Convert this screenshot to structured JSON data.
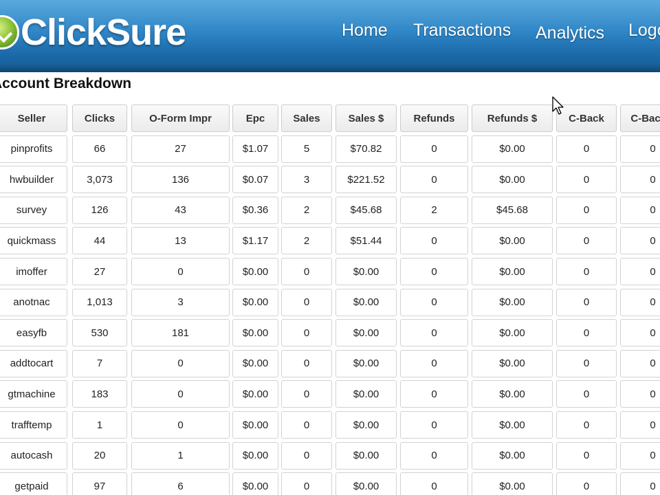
{
  "app": {
    "logo_text": "ClickSure"
  },
  "nav": {
    "items": [
      {
        "label": "Home"
      },
      {
        "label": "Transactions"
      },
      {
        "label": "Analytics"
      },
      {
        "label": "Logout"
      }
    ]
  },
  "section": {
    "title": "Account Breakdown"
  },
  "table": {
    "columns": [
      "Seller",
      "Clicks",
      "O-Form Impr",
      "Epc",
      "Sales",
      "Sales $",
      "Refunds",
      "Refunds $",
      "C-Back",
      "C-Back $"
    ],
    "rows": [
      [
        "pinprofits",
        "66",
        "27",
        "$1.07",
        "5",
        "$70.82",
        "0",
        "$0.00",
        "0",
        "0"
      ],
      [
        "hwbuilder",
        "3,073",
        "136",
        "$0.07",
        "3",
        "$221.52",
        "0",
        "$0.00",
        "0",
        "0"
      ],
      [
        "survey",
        "126",
        "43",
        "$0.36",
        "2",
        "$45.68",
        "2",
        "$45.68",
        "0",
        "0"
      ],
      [
        "quickmass",
        "44",
        "13",
        "$1.17",
        "2",
        "$51.44",
        "0",
        "$0.00",
        "0",
        "0"
      ],
      [
        "imoffer",
        "27",
        "0",
        "$0.00",
        "0",
        "$0.00",
        "0",
        "$0.00",
        "0",
        "0"
      ],
      [
        "anotnac",
        "1,013",
        "3",
        "$0.00",
        "0",
        "$0.00",
        "0",
        "$0.00",
        "0",
        "0"
      ],
      [
        "easyfb",
        "530",
        "181",
        "$0.00",
        "0",
        "$0.00",
        "0",
        "$0.00",
        "0",
        "0"
      ],
      [
        "addtocart",
        "7",
        "0",
        "$0.00",
        "0",
        "$0.00",
        "0",
        "$0.00",
        "0",
        "0"
      ],
      [
        "gtmachine",
        "183",
        "0",
        "$0.00",
        "0",
        "$0.00",
        "0",
        "$0.00",
        "0",
        "0"
      ],
      [
        "trafftemp",
        "1",
        "0",
        "$0.00",
        "0",
        "$0.00",
        "0",
        "$0.00",
        "0",
        "0"
      ],
      [
        "autocash",
        "20",
        "1",
        "$0.00",
        "0",
        "$0.00",
        "0",
        "$0.00",
        "0",
        "0"
      ],
      [
        "getpaid",
        "97",
        "6",
        "$0.00",
        "0",
        "$0.00",
        "0",
        "$0.00",
        "0",
        "0"
      ]
    ]
  },
  "colors": {
    "header_blue": "#2f86c6",
    "logo_green": "#8fc43c"
  }
}
